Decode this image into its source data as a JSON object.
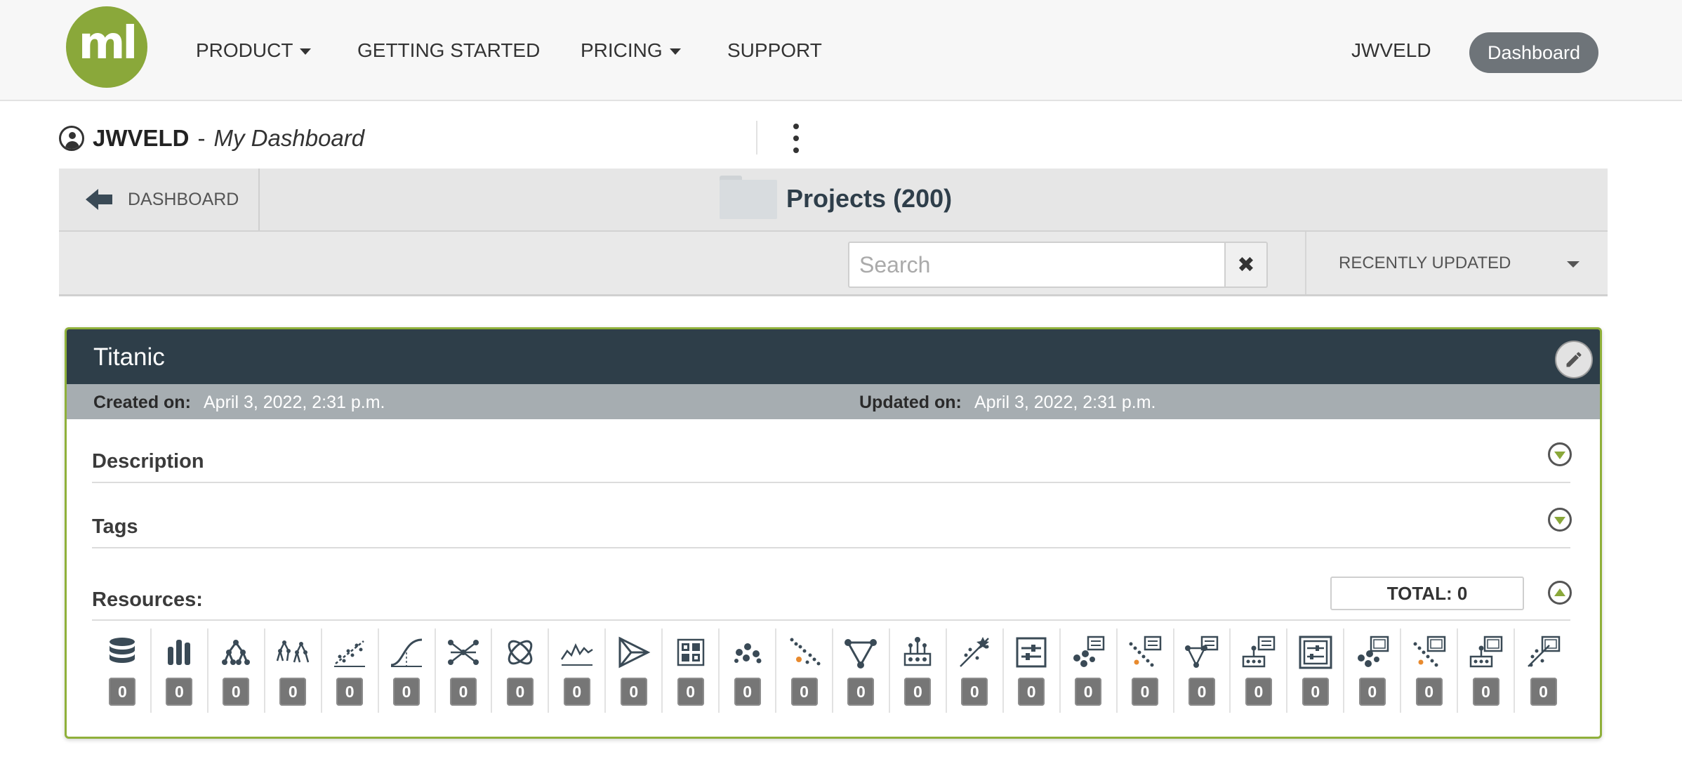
{
  "nav": {
    "logo_text": "ml",
    "items": [
      {
        "label": "PRODUCT",
        "has_caret": true
      },
      {
        "label": "GETTING STARTED",
        "has_caret": false
      },
      {
        "label": "PRICING",
        "has_caret": true
      },
      {
        "label": "SUPPORT",
        "has_caret": false
      }
    ],
    "user": "JWVELD",
    "dashboard_button": "Dashboard"
  },
  "userline": {
    "username": "JWVELD",
    "separator": "-",
    "subtitle": "My Dashboard"
  },
  "projects_bar": {
    "back_label": "DASHBOARD",
    "title": "Projects (200)"
  },
  "toolbar": {
    "search_placeholder": "Search",
    "search_value": "",
    "clear_icon": "✖",
    "sort_label": "RECENTLY UPDATED"
  },
  "card": {
    "title": "Titanic",
    "created_label": "Created on:",
    "created_value": "April 3, 2022, 2:31 p.m.",
    "updated_label": "Updated on:",
    "updated_value": "April 3, 2022, 2:31 p.m.",
    "sections": {
      "description": "Description",
      "tags": "Tags",
      "resources": "Resources:"
    },
    "total_label": "TOTAL: 0",
    "resources": [
      {
        "icon": "source-icon",
        "count": "0"
      },
      {
        "icon": "dataset-icon",
        "count": "0"
      },
      {
        "icon": "model-icon",
        "count": "0"
      },
      {
        "icon": "ensemble-icon",
        "count": "0"
      },
      {
        "icon": "linear-regression-icon",
        "count": "0"
      },
      {
        "icon": "logistic-regression-icon",
        "count": "0"
      },
      {
        "icon": "deepnet-icon",
        "count": "0"
      },
      {
        "icon": "fusion-icon",
        "count": "0"
      },
      {
        "icon": "time-series-icon",
        "count": "0"
      },
      {
        "icon": "optiml-icon",
        "count": "0"
      },
      {
        "icon": "pca-icon",
        "count": "0"
      },
      {
        "icon": "cluster-icon",
        "count": "0"
      },
      {
        "icon": "anomaly-icon",
        "count": "0"
      },
      {
        "icon": "association-icon",
        "count": "0"
      },
      {
        "icon": "topic-model-icon",
        "count": "0"
      },
      {
        "icon": "prediction-icon",
        "count": "0"
      },
      {
        "icon": "evaluation-icon",
        "count": "0"
      },
      {
        "icon": "centroid-icon",
        "count": "0"
      },
      {
        "icon": "anomaly-score-icon",
        "count": "0"
      },
      {
        "icon": "association-set-icon",
        "count": "0"
      },
      {
        "icon": "topic-distribution-icon",
        "count": "0"
      },
      {
        "icon": "batch-prediction-icon",
        "count": "0"
      },
      {
        "icon": "batch-centroid-icon",
        "count": "0"
      },
      {
        "icon": "batch-anomaly-score-icon",
        "count": "0"
      },
      {
        "icon": "batch-topic-distribution-icon",
        "count": "0"
      },
      {
        "icon": "batch-projection-icon",
        "count": "0"
      }
    ]
  },
  "colors": {
    "brand_green": "#8aa83a",
    "card_header": "#2e3e49",
    "date_bar": "#a6adb1",
    "count_badge": "#767676"
  }
}
